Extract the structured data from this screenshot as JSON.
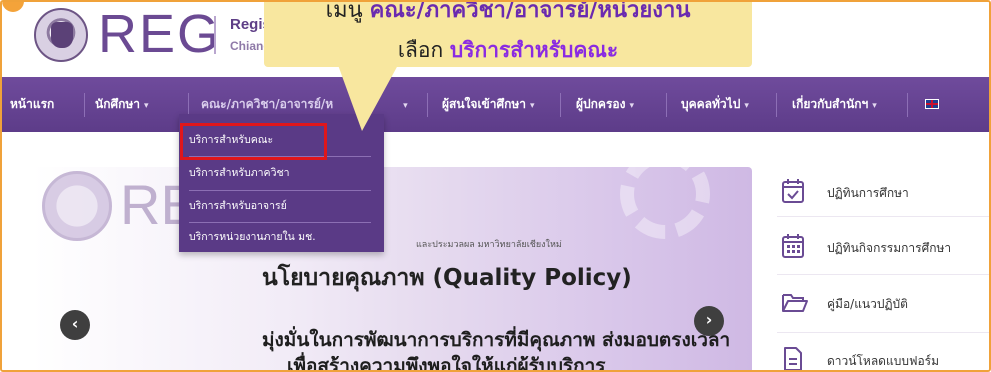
{
  "header": {
    "logo_text": "REG",
    "subtitle_line1": "Registra",
    "subtitle_line2": "Chiang M"
  },
  "nav": {
    "items": [
      {
        "label": "หน้าแรก",
        "caret": ""
      },
      {
        "label": "นักศึกษา",
        "caret": "▾"
      },
      {
        "label": "คณะ/ภาควิชา/อาจารย์/ห",
        "caret": "▾"
      },
      {
        "label": "ผู้สนใจเข้าศึกษา",
        "caret": "▾"
      },
      {
        "label": "ผู้ปกครอง",
        "caret": "▾"
      },
      {
        "label": "บุคคลทั่วไป",
        "caret": "▾"
      },
      {
        "label": "เกี่ยวกับสำนักฯ",
        "caret": "▾"
      }
    ],
    "language_icon": "uk-flag-icon"
  },
  "dropdown": {
    "items": [
      "บริการสำหรับคณะ",
      "บริการสำหรับภาควิชา",
      "บริการสำหรับอาจารย์",
      "บริการหน่วยงานภายใน มช."
    ]
  },
  "callout": {
    "line1_prefix": "เมนู ",
    "line1_bold": "คณะ/ภาควิชา/อาจารย์/หน่วยงาน",
    "line2_prefix": "เลือก ",
    "line2_bold": "บริการสำหรับคณะ"
  },
  "slider": {
    "watermark": "REG",
    "subtitle": "และประมวลผล มหาวิทยาลัยเชียงใหม่",
    "title": "นโยบายคุณภาพ (Quality Policy)",
    "line1": "มุ่งมั่นในการพัฒนาการบริการที่มีคุณภาพ ส่งมอบตรงเวลา",
    "line2": "เพื่อสร้างความพึงพอใจให้แก่ผู้รับบริการ",
    "prev_icon": "‹",
    "next_icon": "›"
  },
  "side_menu": {
    "items": [
      {
        "label": "ปฏิทินการศึกษา",
        "icon": "calendar-check-icon"
      },
      {
        "label": "ปฏิทินกิจกรรมการศึกษา",
        "icon": "calendar-grid-icon"
      },
      {
        "label": "คู่มือ/แนวปฏิบัติ",
        "icon": "folder-open-icon"
      },
      {
        "label": "ดาวน์โหลดแบบฟอร์ม",
        "icon": "document-icon"
      }
    ]
  },
  "colors": {
    "nav_bg": "#5d3c89",
    "accent": "#6b4a93",
    "highlight": "#e0161b",
    "callout_bg": "#f8e79f"
  }
}
